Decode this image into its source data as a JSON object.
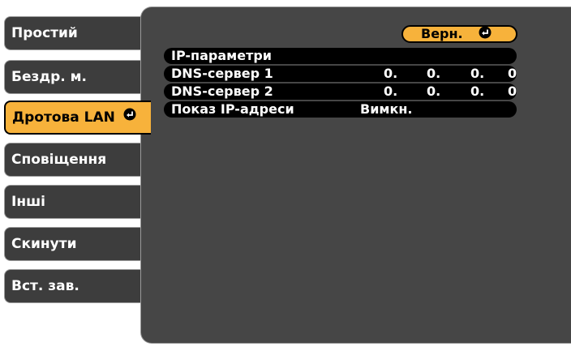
{
  "sidebar": {
    "items": [
      {
        "label": "Простий"
      },
      {
        "label": "Бездр. м."
      },
      {
        "label": "Дротова LAN"
      },
      {
        "label": "Сповіщення"
      },
      {
        "label": "Інші"
      },
      {
        "label": "Скинути"
      },
      {
        "label": "Вст. зав."
      }
    ]
  },
  "panel": {
    "return_label": "Верн.",
    "rows": [
      {
        "label": "IP-параметри"
      },
      {
        "label": "DNS-сервер 1",
        "octets": [
          "0.",
          "0.",
          "0.",
          "0"
        ]
      },
      {
        "label": "DNS-сервер 2",
        "octets": [
          "0.",
          "0.",
          "0.",
          "0"
        ]
      },
      {
        "label": "Показ IP-адреси",
        "value": "Вимкн."
      }
    ]
  },
  "colors": {
    "accent": "#f7b23b",
    "panel_bg": "#464646",
    "tab_bg": "#3d3d3d",
    "row_bg": "#000000"
  },
  "icons": {
    "enter": "enter-icon"
  }
}
